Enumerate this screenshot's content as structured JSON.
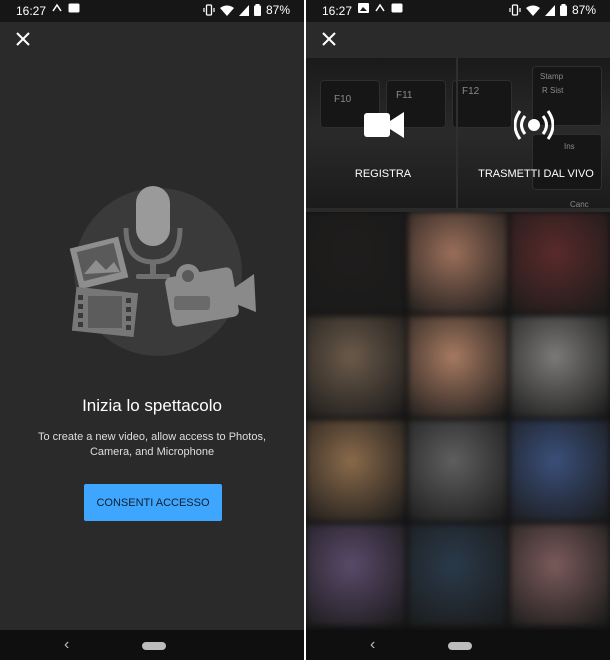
{
  "screen_left": {
    "status_bar": {
      "time": "16:27",
      "battery": "87%"
    },
    "close_label": "close",
    "title": "Inizia lo spettacolo",
    "description": "To create a new video, allow access to Photos, Camera, and Microphone",
    "allow_button": "CONSENTI ACCESSO",
    "illustration_icons": [
      "microphone-icon",
      "photo-icon",
      "film-icon",
      "video-camera-icon"
    ]
  },
  "screen_right": {
    "status_bar": {
      "time": "16:27",
      "battery": "87%"
    },
    "camera_preview_key_labels": [
      "F10",
      "F11",
      "F12",
      "Stamp",
      "R Sist",
      "Ins",
      "Canc"
    ],
    "modes": [
      {
        "label": "REGISTRA",
        "icon": "video-camera-icon"
      },
      {
        "label": "TRASMETTI DAL VIVO",
        "icon": "live-broadcast-icon"
      }
    ],
    "gallery_thumbs": [
      "#1f1d1c",
      "#9b6f5a",
      "#5a2a2a",
      "#6b5a4a",
      "#a77a60",
      "#7c7a78",
      "#8a6a4a",
      "#5f5f5f",
      "#3a4f7a",
      "#5a4a6a",
      "#2a3a4a",
      "#7a5a5a"
    ]
  }
}
